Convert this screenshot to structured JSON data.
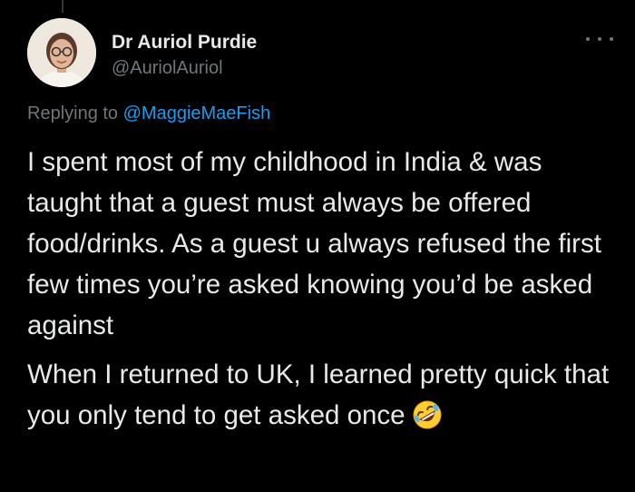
{
  "tweet": {
    "author": {
      "display_name": "Dr Auriol Purdie",
      "handle": "@AuriolAuriol",
      "avatar_icon": "profile-photo"
    },
    "more_icon": "more-horizontal-icon",
    "replying_prefix": "Replying to",
    "replying_to": "@MaggieMaeFish",
    "paragraphs": [
      "I spent most of my childhood in India & was taught that a guest must always be offered food/drinks. As a guest u always refused the first few times you’re asked knowing you’d be asked against",
      "When I returned to UK, I learned pretty quick that you only tend to get asked once"
    ],
    "emoji": "rolling-on-floor-laughing-emoji"
  },
  "colors": {
    "background": "#000000",
    "text": "#e7e9ea",
    "secondary": "#71767b",
    "accent": "#1d9bf0"
  }
}
